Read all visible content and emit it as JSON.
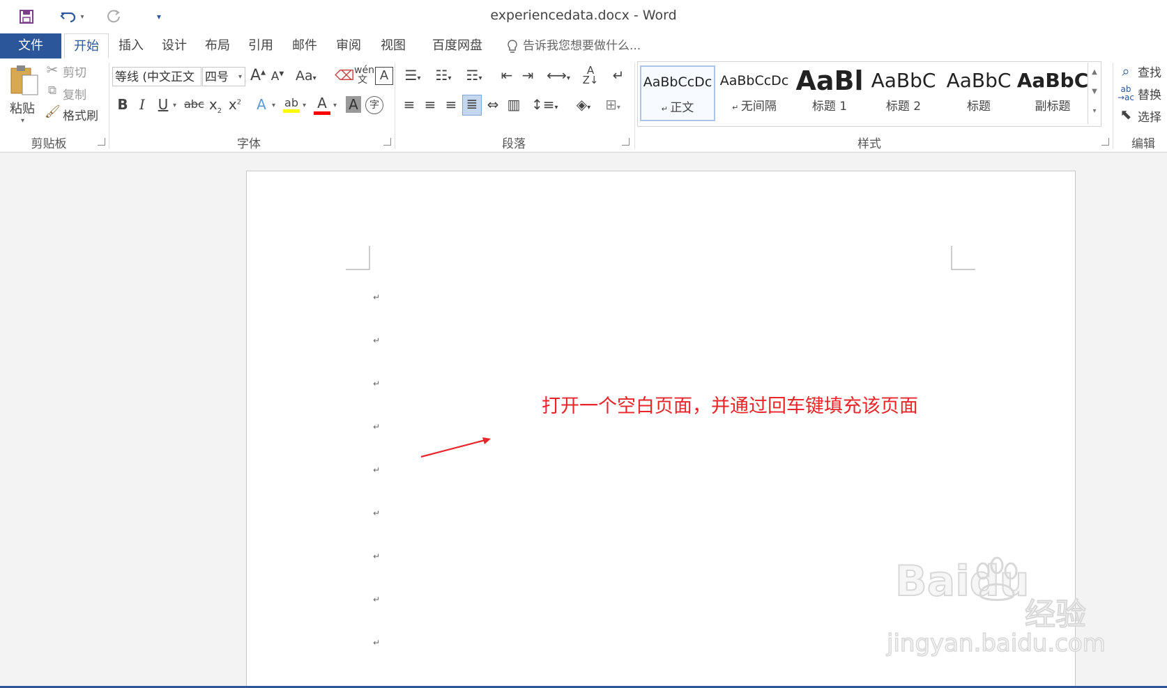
{
  "window": {
    "title": "experiencedata.docx - Word"
  },
  "quick_access": {
    "save_icon": "save-icon",
    "undo_icon": "undo-icon",
    "redo_icon": "redo-icon",
    "customize_icon": "customize-qat-icon"
  },
  "tabs": [
    {
      "label": "文件"
    },
    {
      "label": "开始"
    },
    {
      "label": "插入"
    },
    {
      "label": "设计"
    },
    {
      "label": "布局"
    },
    {
      "label": "引用"
    },
    {
      "label": "邮件"
    },
    {
      "label": "审阅"
    },
    {
      "label": "视图"
    },
    {
      "label": "百度网盘"
    }
  ],
  "tell_me": {
    "placeholder": "告诉我您想要做什么..."
  },
  "clipboard": {
    "paste": "粘贴",
    "cut": "剪切",
    "copy": "复制",
    "format_painter": "格式刷",
    "group": "剪贴板"
  },
  "font": {
    "name": "等线 (中文正文",
    "size": "四号",
    "change_case": "Aa",
    "group": "字体",
    "colors": {
      "highlight": "#ffff00",
      "font_color": "#ff0000"
    }
  },
  "paragraph": {
    "group": "段落"
  },
  "styles": {
    "items": [
      {
        "preview": "AaBbCcDc",
        "name": "正文"
      },
      {
        "preview": "AaBbCcDc",
        "name": "无间隔"
      },
      {
        "preview": "AaBl",
        "name": "标题 1"
      },
      {
        "preview": "AaBbC",
        "name": "标题 2"
      },
      {
        "preview": "AaBbC",
        "name": "标题"
      },
      {
        "preview": "AaBbC",
        "name": "副标题"
      }
    ],
    "group": "样式"
  },
  "editing": {
    "find": "查找",
    "replace": "替换",
    "select": "选择",
    "group": "编辑"
  },
  "document": {
    "paragraph_mark": "↵",
    "annotation": "打开一个空白页面，并通过回车键填充该页面"
  },
  "watermark": {
    "brand": "Baidu",
    "brand_cn": "经验",
    "url": "jingyan.baidu.com"
  },
  "colors": {
    "accent": "#2b579a",
    "annotation": "#e8262a"
  }
}
